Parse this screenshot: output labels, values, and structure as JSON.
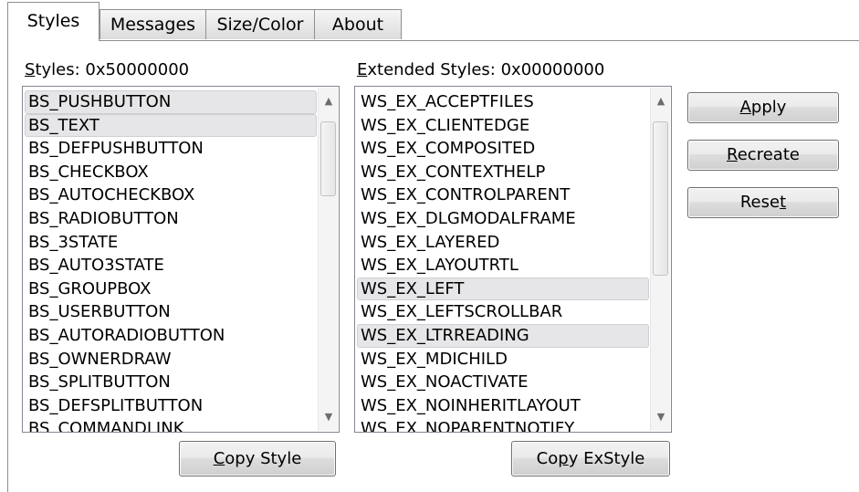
{
  "tabs": [
    {
      "label": "Styles"
    },
    {
      "label": "Messages"
    },
    {
      "label": "Size/Color"
    },
    {
      "label": "About"
    }
  ],
  "styles_label": {
    "pre": "",
    "key": "S",
    "post": "tyles: 0x50000000"
  },
  "extended_label": {
    "pre": "",
    "key": "E",
    "post": "xtended Styles: 0x00000000"
  },
  "styles_list": [
    "BS_PUSHBUTTON",
    "BS_TEXT",
    "BS_DEFPUSHBUTTON",
    "BS_CHECKBOX",
    "BS_AUTOCHECKBOX",
    "BS_RADIOBUTTON",
    "BS_3STATE",
    "BS_AUTO3STATE",
    "BS_GROUPBOX",
    "BS_USERBUTTON",
    "BS_AUTORADIOBUTTON",
    "BS_OWNERDRAW",
    "BS_SPLITBUTTON",
    "BS_DEFSPLITBUTTON",
    "BS_COMMANDLINK"
  ],
  "styles_selected": [
    0,
    1
  ],
  "ext_list": [
    "WS_EX_ACCEPTFILES",
    "WS_EX_CLIENTEDGE",
    "WS_EX_COMPOSITED",
    "WS_EX_CONTEXTHELP",
    "WS_EX_CONTROLPARENT",
    "WS_EX_DLGMODALFRAME",
    "WS_EX_LAYERED",
    "WS_EX_LAYOUTRTL",
    "WS_EX_LEFT",
    "WS_EX_LEFTSCROLLBAR",
    "WS_EX_LTRREADING",
    "WS_EX_MDICHILD",
    "WS_EX_NOACTIVATE",
    "WS_EX_NOINHERITLAYOUT",
    "WS_EX_NOPARENTNOTIFY"
  ],
  "ext_selected": [
    8,
    10
  ],
  "buttons": {
    "apply": {
      "pre": "",
      "key": "A",
      "post": "pply"
    },
    "recreate": {
      "pre": "",
      "key": "R",
      "post": "ecreate"
    },
    "reset": {
      "pre": "Rese",
      "key": "t",
      "post": ""
    },
    "copy_style": {
      "pre": "",
      "key": "C",
      "post": "opy Style"
    },
    "copy_exstyle": {
      "pre": "Co",
      "key": "p",
      "post": "y ExStyle"
    }
  },
  "icons": {
    "scroll_up": "▲",
    "scroll_down": "▼"
  },
  "colors": {
    "selection_bg": "#e6e6e8",
    "border": "#828790"
  }
}
